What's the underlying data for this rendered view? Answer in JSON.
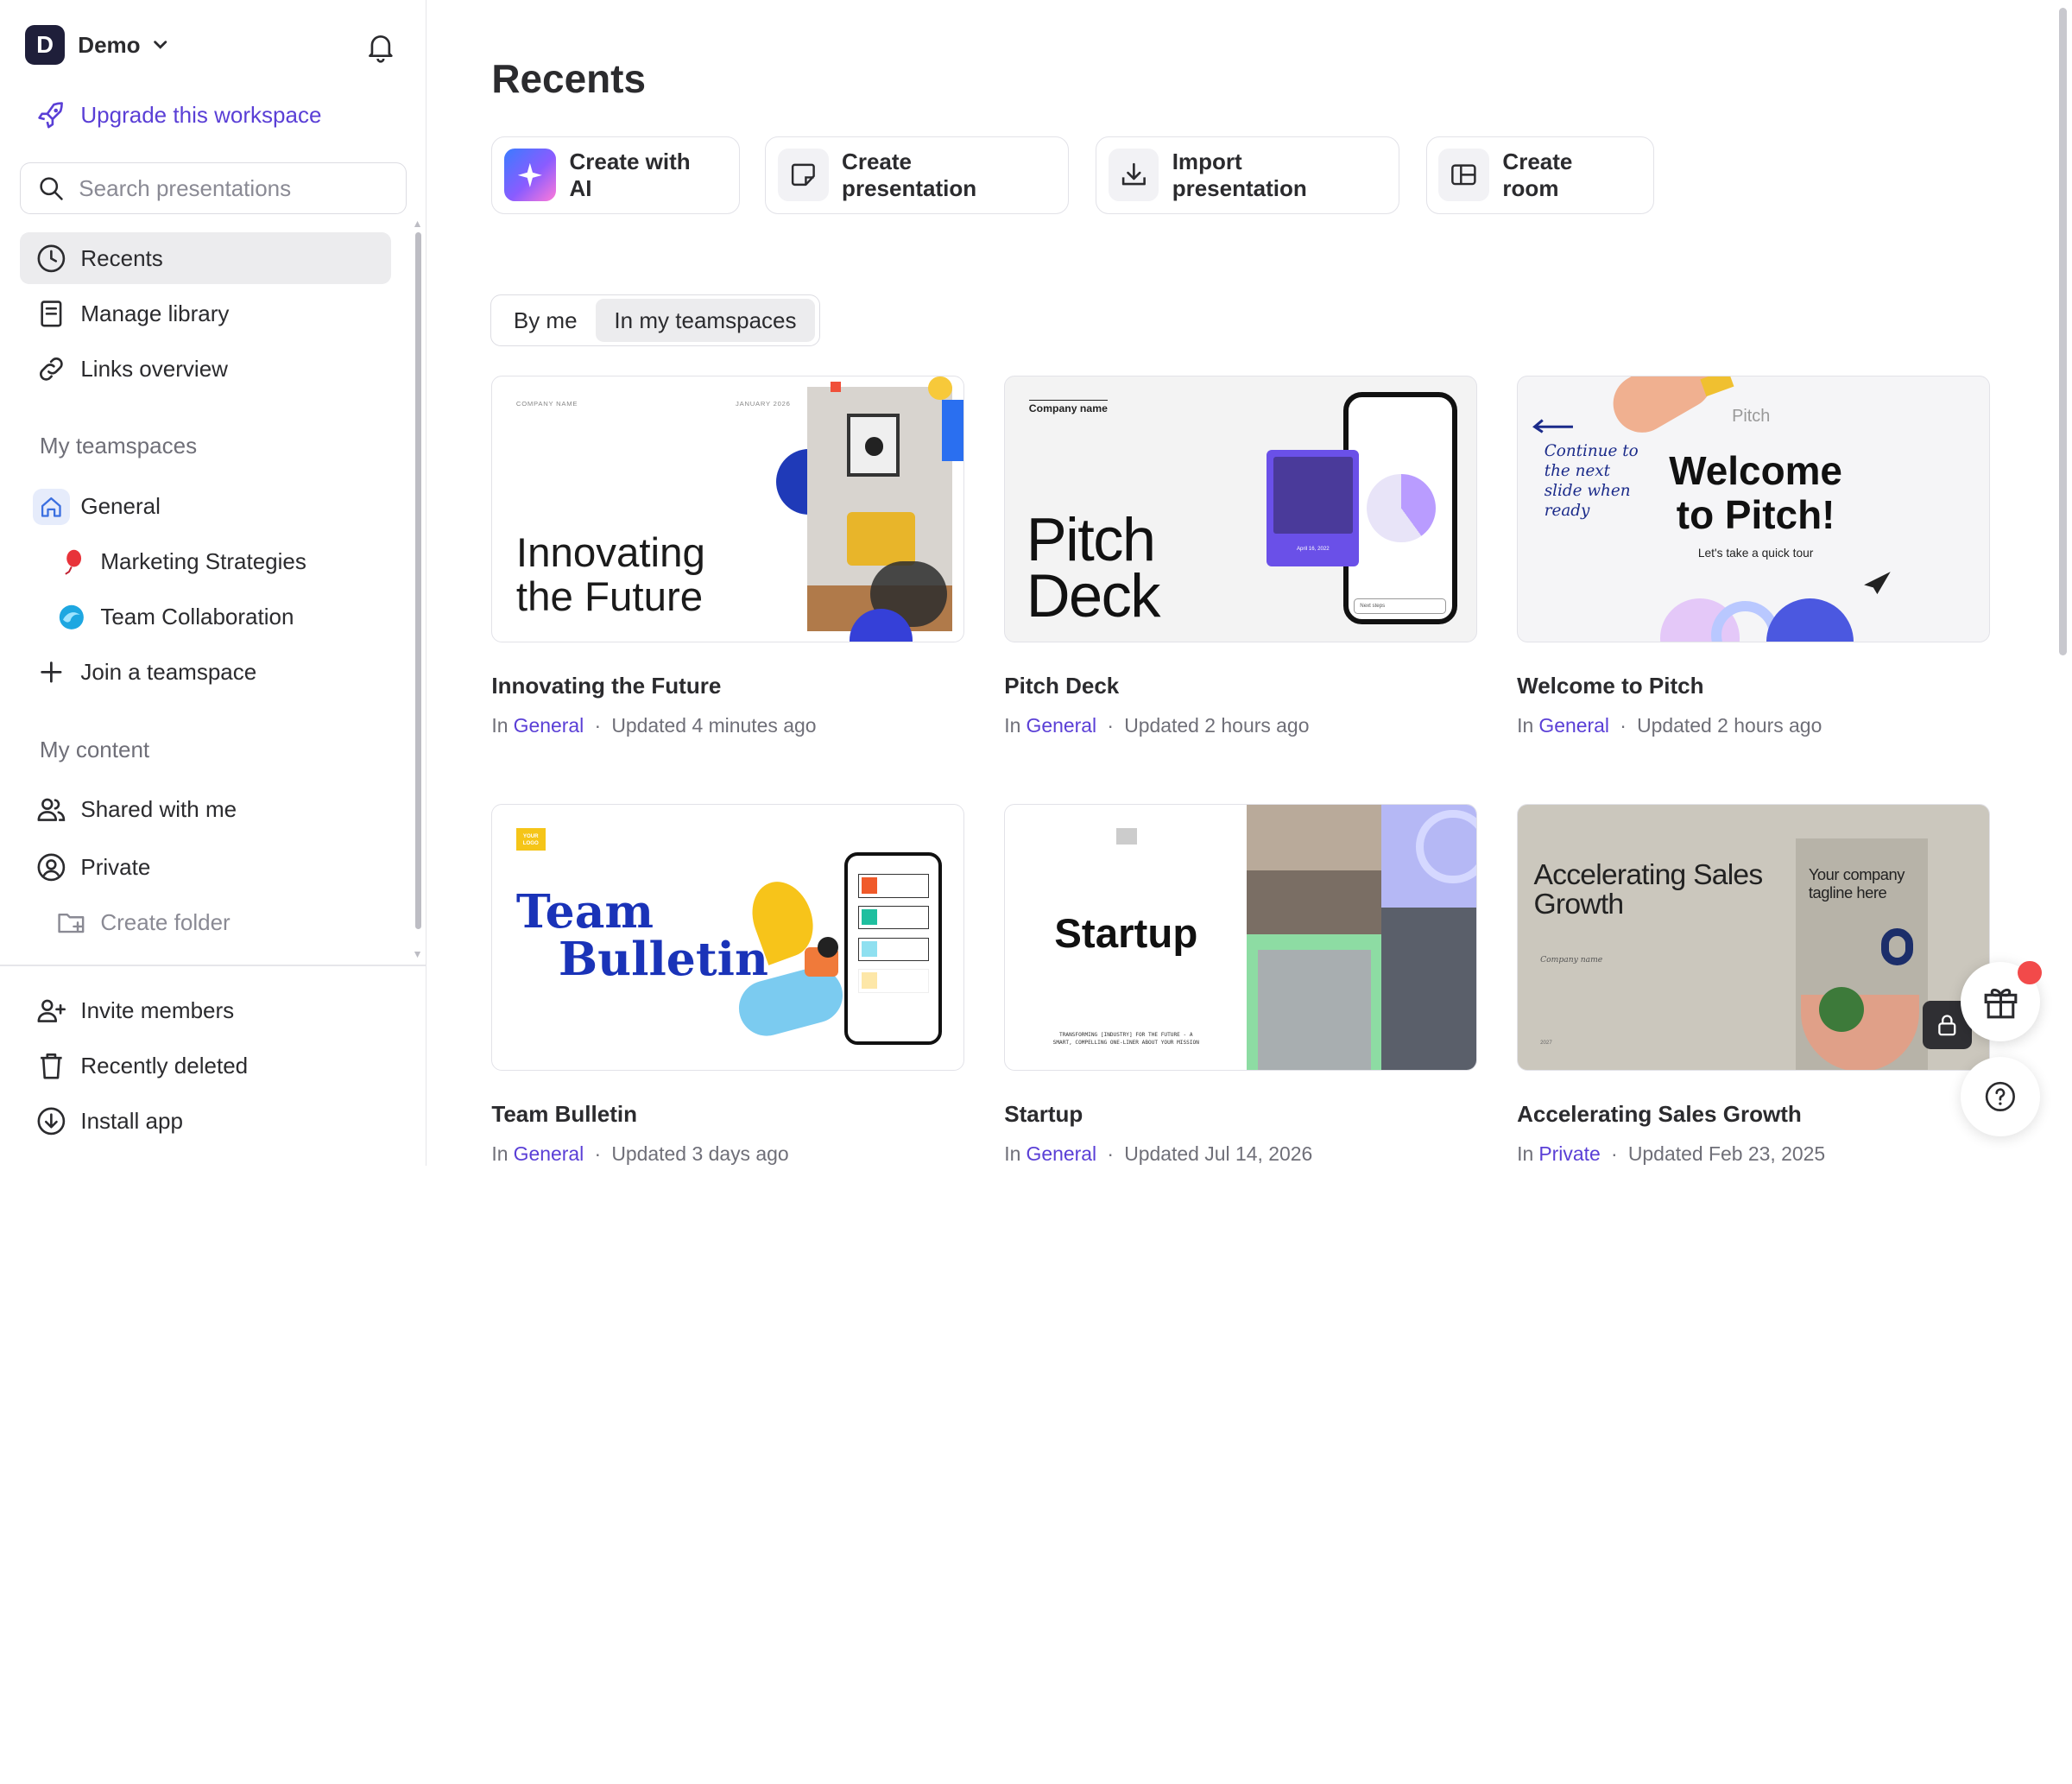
{
  "workspace": {
    "initial": "D",
    "name": "Demo"
  },
  "sidebar": {
    "upgrade_label": "Upgrade this workspace",
    "search_placeholder": "Search presentations",
    "nav": [
      {
        "label": "Recents",
        "icon": "clock-icon",
        "active": true
      },
      {
        "label": "Manage library",
        "icon": "library-icon"
      },
      {
        "label": "Links overview",
        "icon": "link-icon"
      }
    ],
    "teamspaces_label": "My teamspaces",
    "teamspace": {
      "label": "General",
      "icon": "home-icon"
    },
    "subitems": [
      {
        "label": "Marketing Strategies",
        "icon": "balloon-icon"
      },
      {
        "label": "Team Collaboration",
        "icon": "wave-icon"
      }
    ],
    "join_label": "Join a teamspace",
    "content_label": "My content",
    "content": [
      {
        "label": "Shared with me",
        "icon": "users-icon"
      },
      {
        "label": "Private",
        "icon": "user-circle-icon"
      }
    ],
    "create_folder_label": "Create folder",
    "footer": [
      {
        "label": "Invite members",
        "icon": "user-plus-icon"
      },
      {
        "label": "Recently deleted",
        "icon": "trash-icon"
      },
      {
        "label": "Install app",
        "icon": "download-icon"
      }
    ]
  },
  "main": {
    "title": "Recents",
    "actions": [
      {
        "label": "Create with AI",
        "icon": "sparkle-icon"
      },
      {
        "label": "Create presentation",
        "icon": "presentation-icon"
      },
      {
        "label": "Import presentation",
        "icon": "import-icon"
      },
      {
        "label": "Create room",
        "icon": "room-icon"
      }
    ],
    "tabs": [
      {
        "label": "By me",
        "active": false
      },
      {
        "label": "In my teamspaces",
        "active": true
      }
    ],
    "cards": [
      {
        "title": "Innovating the Future",
        "in_prefix": "In",
        "location": "General",
        "updated": "Updated 4 minutes ago"
      },
      {
        "title": "Pitch Deck",
        "in_prefix": "In",
        "location": "General",
        "updated": "Updated 2 hours ago"
      },
      {
        "title": "Welcome to Pitch",
        "in_prefix": "In",
        "location": "General",
        "updated": "Updated 2 hours ago"
      },
      {
        "title": "Team Bulletin",
        "in_prefix": "In",
        "location": "General",
        "updated": "Updated 3 days ago"
      },
      {
        "title": "Startup",
        "in_prefix": "In",
        "location": "General",
        "updated": "Updated Jul 14, 2026"
      },
      {
        "title": "Accelerating Sales Growth",
        "in_prefix": "In",
        "location": "Private",
        "updated": "Updated Feb 23, 2025"
      }
    ],
    "thumbs": {
      "innovating": {
        "company": "COMPANY NAME",
        "date": "JANUARY 2026",
        "headline_1": "Innovating",
        "headline_2": "the Future"
      },
      "pitch": {
        "company": "Company name",
        "headline_1": "Pitch",
        "headline_2": "Deck",
        "phone_date": "April 16, 2022",
        "phone_next": "Next steps"
      },
      "welcome": {
        "brand": "Pitch",
        "note_1": "Continue to",
        "note_2": "the next",
        "note_3": "slide when",
        "note_4": "ready",
        "headline_1": "Welcome",
        "headline_2": "to Pitch!",
        "sub": "Let's take a quick tour"
      },
      "bulletin": {
        "logo": "YOUR LOGO",
        "headline_1": "Team",
        "headline_2": "Bulletin"
      },
      "startup": {
        "headline": "Startup",
        "tagline_1": "TRANSFORMING [INDUSTRY] FOR THE FUTURE - A",
        "tagline_2": "SMART, COMPELLING ONE-LINER ABOUT YOUR MISSION"
      },
      "sales": {
        "headline_1": "Accelerating Sales",
        "headline_2": "Growth",
        "company": "Company name",
        "tagline_1": "Your company",
        "tagline_2": "tagline here",
        "year": "2027"
      }
    }
  },
  "colors": {
    "accent": "#5a3fd6",
    "badge": "#f24a4a"
  }
}
